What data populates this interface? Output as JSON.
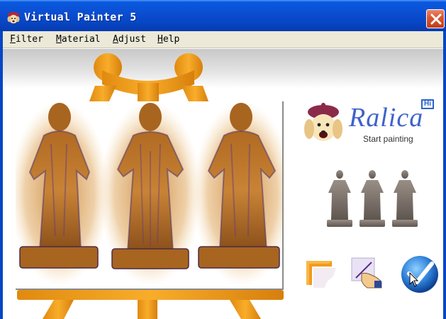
{
  "window": {
    "title": "Virtual Painter 5"
  },
  "menu": {
    "items": [
      {
        "label": "Filter",
        "accel": "F",
        "rest": "ilter"
      },
      {
        "label": "Material",
        "accel": "M",
        "rest": "aterial"
      },
      {
        "label": "Adjust",
        "accel": "A",
        "rest": "djust"
      },
      {
        "label": "Help",
        "accel": "H",
        "rest": "elp"
      }
    ]
  },
  "logo": {
    "brand": "Ralica",
    "badge": "Hi",
    "tagline": "Start painting"
  },
  "colors": {
    "title_bar": "#0746c4",
    "easel_orange": "#f5a21c",
    "statue_brown": "#a8651f",
    "brand_blue": "#3f63c9",
    "close_red": "#d9552f"
  },
  "icons": {
    "app": "painter-face-icon",
    "close": "close-icon",
    "frame_tool": "frame-icon",
    "paint_tool": "hand-brush-icon",
    "apply_tool": "checkmark-icon"
  }
}
